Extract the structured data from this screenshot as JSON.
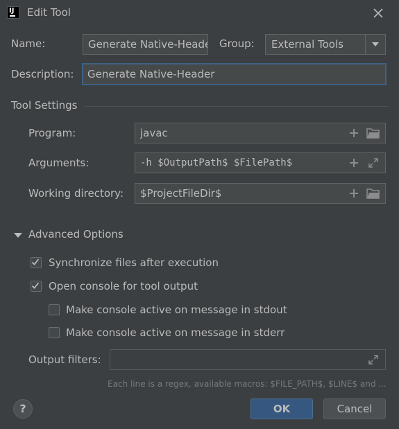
{
  "dialog": {
    "title": "Edit Tool"
  },
  "form": {
    "name_label": "Name:",
    "name_value": "Generate Native-Header",
    "group_label": "Group:",
    "group_value": "External Tools",
    "description_label": "Description:",
    "description_value": "Generate Native-Header"
  },
  "tool_settings": {
    "header": "Tool Settings",
    "program_label": "Program:",
    "program_value": "javac",
    "arguments_label": "Arguments:",
    "arguments_value": "-h $OutputPath$ $FilePath$",
    "workdir_label": "Working directory:",
    "workdir_value": "$ProjectFileDir$"
  },
  "advanced": {
    "header": "Advanced Options",
    "options": [
      {
        "label": "Synchronize files after execution",
        "checked": true
      },
      {
        "label": "Open console for tool output",
        "checked": true
      },
      {
        "label": "Make console active on message in stdout",
        "checked": false
      },
      {
        "label": "Make console active on message in stderr",
        "checked": false
      }
    ],
    "output_filters_label": "Output filters:",
    "output_filters_value": "",
    "hint": "Each line is a regex, available macros: $FILE_PATH$, $LINE$ and ..."
  },
  "buttons": {
    "help": "?",
    "ok": "OK",
    "cancel": "Cancel"
  },
  "colors": {
    "background": "#3c3f41",
    "field": "#45494a",
    "focus_border": "#3d6185",
    "primary_button": "#365880"
  },
  "icons": [
    "app-icon",
    "close-icon",
    "add-icon",
    "folder-icon",
    "expand-icon",
    "chevron-down-icon",
    "triangle-down-icon",
    "check-icon",
    "help-icon"
  ]
}
